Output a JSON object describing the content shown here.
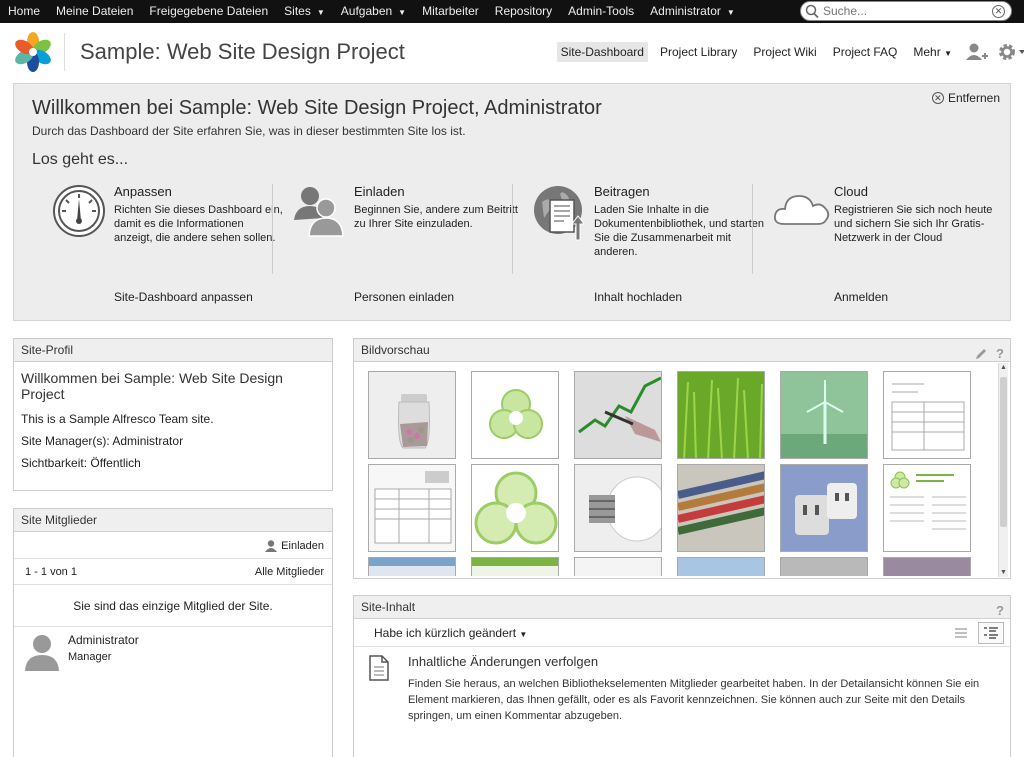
{
  "topnav": {
    "items": [
      {
        "label": "Home"
      },
      {
        "label": "Meine Dateien"
      },
      {
        "label": "Freigegebene Dateien"
      },
      {
        "label": "Sites",
        "dropdown": true
      },
      {
        "label": "Aufgaben",
        "dropdown": true
      },
      {
        "label": "Mitarbeiter"
      },
      {
        "label": "Repository"
      },
      {
        "label": "Admin-Tools"
      },
      {
        "label": "Administrator",
        "dropdown": true
      }
    ],
    "search_placeholder": "Suche..."
  },
  "header": {
    "site_title": "Sample: Web Site Design Project",
    "nav": [
      {
        "label": "Site-Dashboard",
        "active": true
      },
      {
        "label": "Project Library"
      },
      {
        "label": "Project Wiki"
      },
      {
        "label": "Project FAQ"
      },
      {
        "label": "Mehr"
      }
    ]
  },
  "welcome": {
    "title": "Willkommen bei Sample: Web Site Design Project, Administrator",
    "subtitle": "Durch das Dashboard der Site erfahren Sie, was in dieser bestimmten Site los ist.",
    "remove_label": "Entfernen",
    "getting_started": "Los geht es...",
    "columns": [
      {
        "icon": "gauge-icon",
        "title": "Anpassen",
        "desc": "Richten Sie dieses Dashboard ein, damit es die Informationen anzeigt, die andere sehen sollen.",
        "link": "Site-Dashboard anpassen"
      },
      {
        "icon": "people-icon",
        "title": "Einladen",
        "desc": "Beginnen Sie, andere zum Beitritt zu Ihrer Site einzuladen.",
        "link": "Personen einladen"
      },
      {
        "icon": "upload-document-icon",
        "title": "Beitragen",
        "desc": "Laden Sie Inhalte in die Dokumentenbibliothek, und starten Sie die Zusammenarbeit mit anderen.",
        "link": "Inhalt hochladen"
      },
      {
        "icon": "cloud-icon",
        "title": "Cloud",
        "desc": "Registrieren Sie sich noch heute und sichern Sie sich Ihr Gratis-Netzwerk in der Cloud",
        "link": "Anmelden"
      }
    ]
  },
  "site_profile": {
    "title": "Site-Profil",
    "heading": "Willkommen bei Sample: Web Site Design Project",
    "description": "This is a Sample Alfresco Team site.",
    "managers": "Site Manager(s): Administrator",
    "visibility": "Sichtbarkeit: Öffentlich"
  },
  "site_members": {
    "title": "Site Mitglieder",
    "invite_label": "Einladen",
    "paging": "1 - 1 von 1",
    "all_members": "Alle Mitglieder",
    "only_member": "Sie sind das einzige Mitglied der Site.",
    "members": [
      {
        "name": "Administrator",
        "role": "Manager"
      }
    ]
  },
  "image_preview": {
    "title": "Bildvorschau",
    "thumbnails": [
      "coin-jar-thumbnail",
      "alfresco-logo-small-thumbnail",
      "chart-hand-thumbnail",
      "grass-thumbnail",
      "wind-turbine-thumbnail",
      "document-form-thumbnail",
      "invoice-document-thumbnail",
      "alfresco-logo-large-thumbnail",
      "light-bulb-thumbnail",
      "pencils-thumbnail",
      "power-adapter-thumbnail",
      "green-newsletter-thumbnail",
      "screenshot-thumbnail",
      "spreadsheet-thumbnail",
      "white-thumbnail",
      "sky-thumbnail",
      "gray-thumbnail",
      "cables-thumbnail"
    ]
  },
  "site_content": {
    "title": "Site-Inhalt",
    "filter": "Habe ich kürzlich geändert",
    "empty_title": "Inhaltliche Änderungen verfolgen",
    "empty_desc": "Finden Sie heraus, an welchen Bibliothekselementen Mitglieder gearbeitet haben. In der Detailansicht können Sie ein Element markieren, das Ihnen gefällt, oder es als Favorit kennzeichnen. Sie können auch zur Seite mit den Details springen, um einen Kommentar abzugeben."
  },
  "colors": {
    "topbar": "#111111",
    "panel_header": "#efefef",
    "welcome_bg": "#ededed"
  }
}
